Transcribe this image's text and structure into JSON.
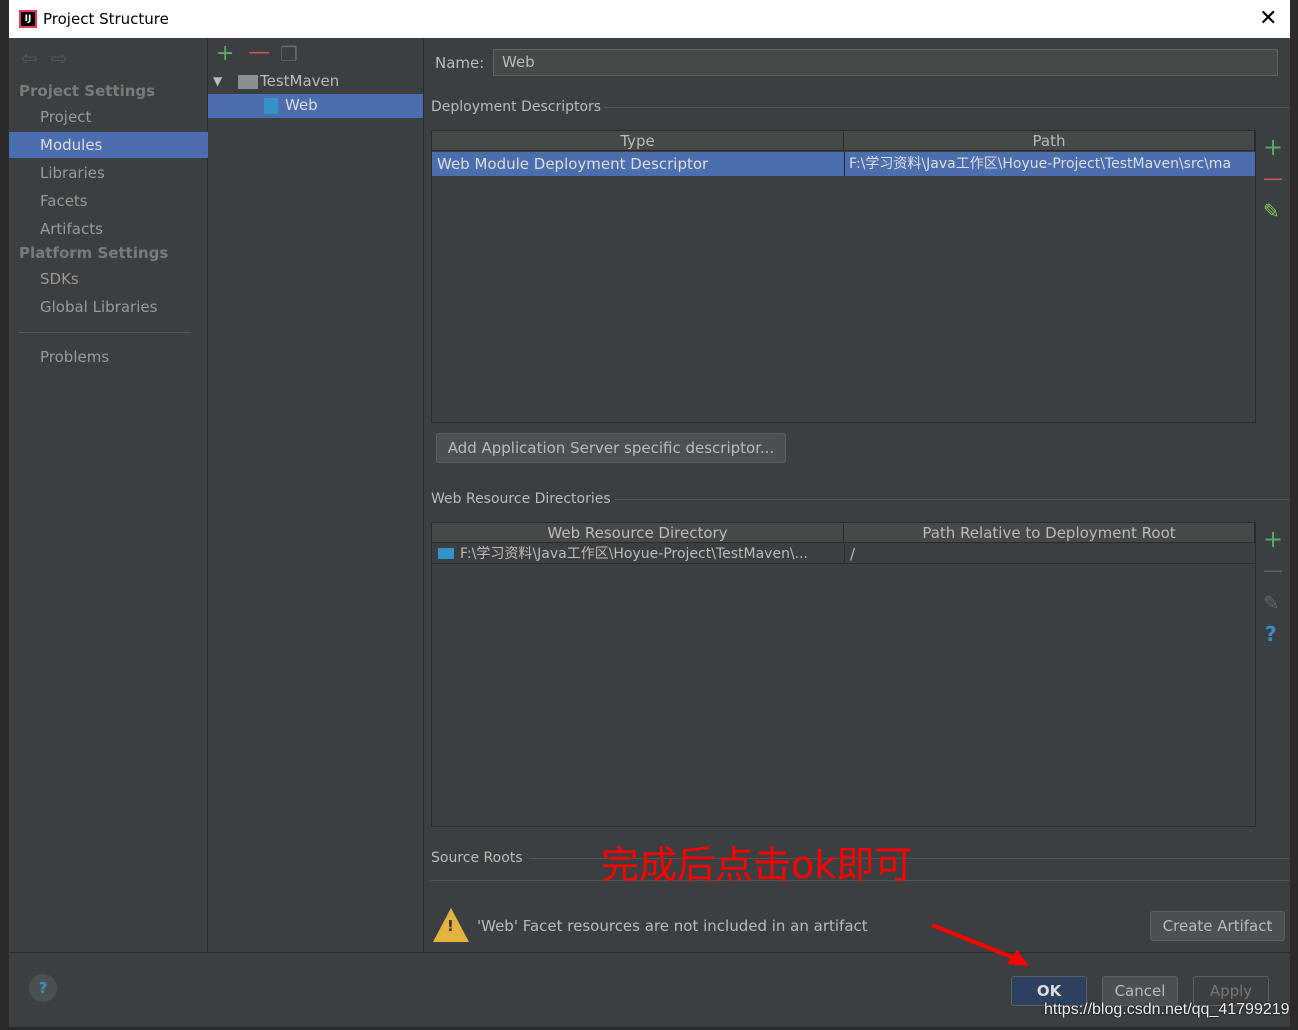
{
  "window": {
    "title": "Project Structure"
  },
  "sidebar": {
    "project_settings": "Project Settings",
    "items": [
      {
        "label": "Project"
      },
      {
        "label": "Modules"
      },
      {
        "label": "Libraries"
      },
      {
        "label": "Facets"
      },
      {
        "label": "Artifacts"
      }
    ],
    "platform_settings": "Platform Settings",
    "platform_items": [
      {
        "label": "SDKs"
      },
      {
        "label": "Global Libraries"
      }
    ],
    "problems": "Problems"
  },
  "tree": {
    "root": "TestMaven",
    "child": "Web"
  },
  "main": {
    "name_label": "Name:",
    "name_value": "Web",
    "deployment": {
      "title": "Deployment Descriptors",
      "columns": [
        "Type",
        "Path"
      ],
      "rows": [
        {
          "type": "Web Module Deployment Descriptor",
          "path": "F:\\学习资料\\Java工作区\\Hoyue-Project\\TestMaven\\src\\ma"
        }
      ],
      "add_server_button": "Add Application Server specific descriptor..."
    },
    "web_resources": {
      "title": "Web Resource Directories",
      "columns": [
        "Web Resource Directory",
        "Path Relative to Deployment Root"
      ],
      "rows": [
        {
          "dir": "F:\\学习资料\\Java工作区\\Hoyue-Project\\TestMaven\\...",
          "rel": "/"
        }
      ]
    },
    "source_roots": "Source Roots",
    "warning": "'Web' Facet resources are not included in an artifact",
    "create_artifact": "Create Artifact"
  },
  "annotation": "完成后点击ok即可",
  "footer": {
    "ok": "OK",
    "cancel": "Cancel",
    "apply": "Apply",
    "watermark": "https://blog.csdn.net/qq_41799219"
  },
  "colors": {
    "selection": "#4b6eaf",
    "add": "#59a869",
    "remove": "#c75450",
    "annotation": "#ff0000"
  }
}
